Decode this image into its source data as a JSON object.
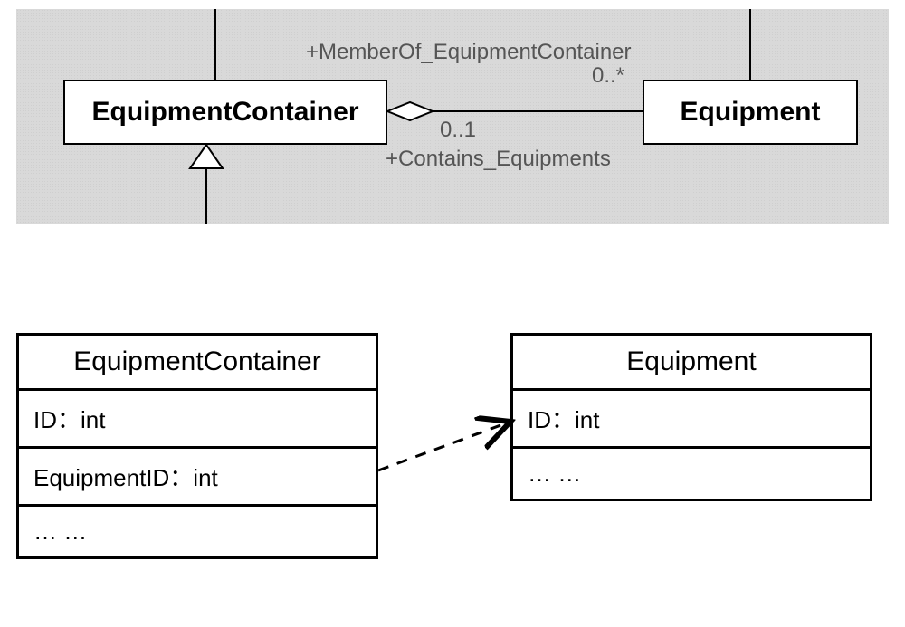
{
  "uml": {
    "classes": {
      "container": "EquipmentContainer",
      "equipment": "Equipment"
    },
    "association": {
      "top_label": "+MemberOf_EquipmentContainer",
      "top_mult": "0..*",
      "bottom_mult": "0..1",
      "bottom_label": "+Contains_Equipments"
    }
  },
  "schema": {
    "left": {
      "title": "EquipmentContainer",
      "rows": [
        "ID：int",
        "EquipmentID：int",
        "… …"
      ]
    },
    "right": {
      "title": "Equipment",
      "rows": [
        "ID：int",
        "… …"
      ]
    }
  }
}
